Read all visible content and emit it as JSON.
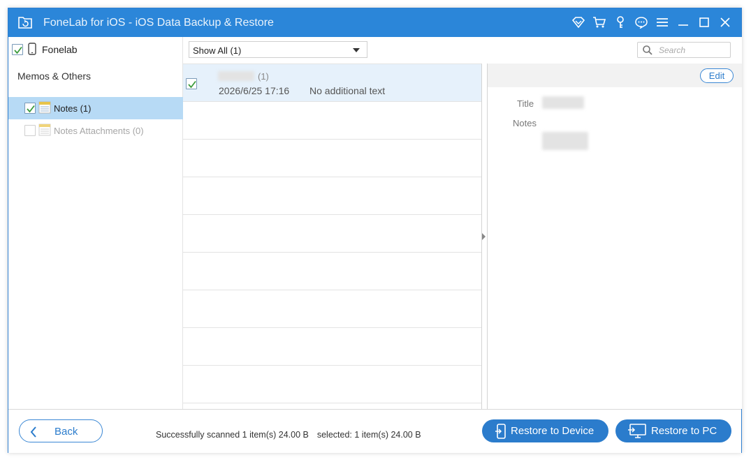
{
  "window": {
    "title": "FoneLab for iOS - iOS Data Backup & Restore"
  },
  "titlebar_icons": [
    "wifi-icon",
    "cart-icon",
    "key-icon",
    "chat-icon",
    "menu-icon",
    "minimize-icon",
    "maximize-icon",
    "close-icon"
  ],
  "sidebar": {
    "device": {
      "label": "Fonelab",
      "checked": true
    },
    "section": "Memos & Others",
    "items": [
      {
        "label": "Notes (1)",
        "checked": true,
        "selected": true
      },
      {
        "label": "Notes Attachments (0)",
        "checked": false,
        "disabled": true
      }
    ]
  },
  "filter": {
    "selected": "Show All (1)"
  },
  "search": {
    "placeholder": "Search"
  },
  "list": {
    "rows": [
      {
        "count": "(1)",
        "date": "2026/6/25 17:16",
        "text": "No additional text",
        "checked": true
      }
    ]
  },
  "detail": {
    "edit_label": "Edit",
    "title_label": "Title",
    "notes_label": "Notes"
  },
  "footer": {
    "back_label": "Back",
    "status_scanned": "Successfully scanned 1 item(s) 24.00 B",
    "status_selected": "selected: 1 item(s) 24.00 B",
    "restore_device_label": "Restore to Device",
    "restore_pc_label": "Restore to PC"
  },
  "colors": {
    "accent": "#2b7ccc",
    "titlebar": "#2b86d9",
    "selection": "#b7daf5",
    "row_highlight": "#e6f1fb"
  }
}
